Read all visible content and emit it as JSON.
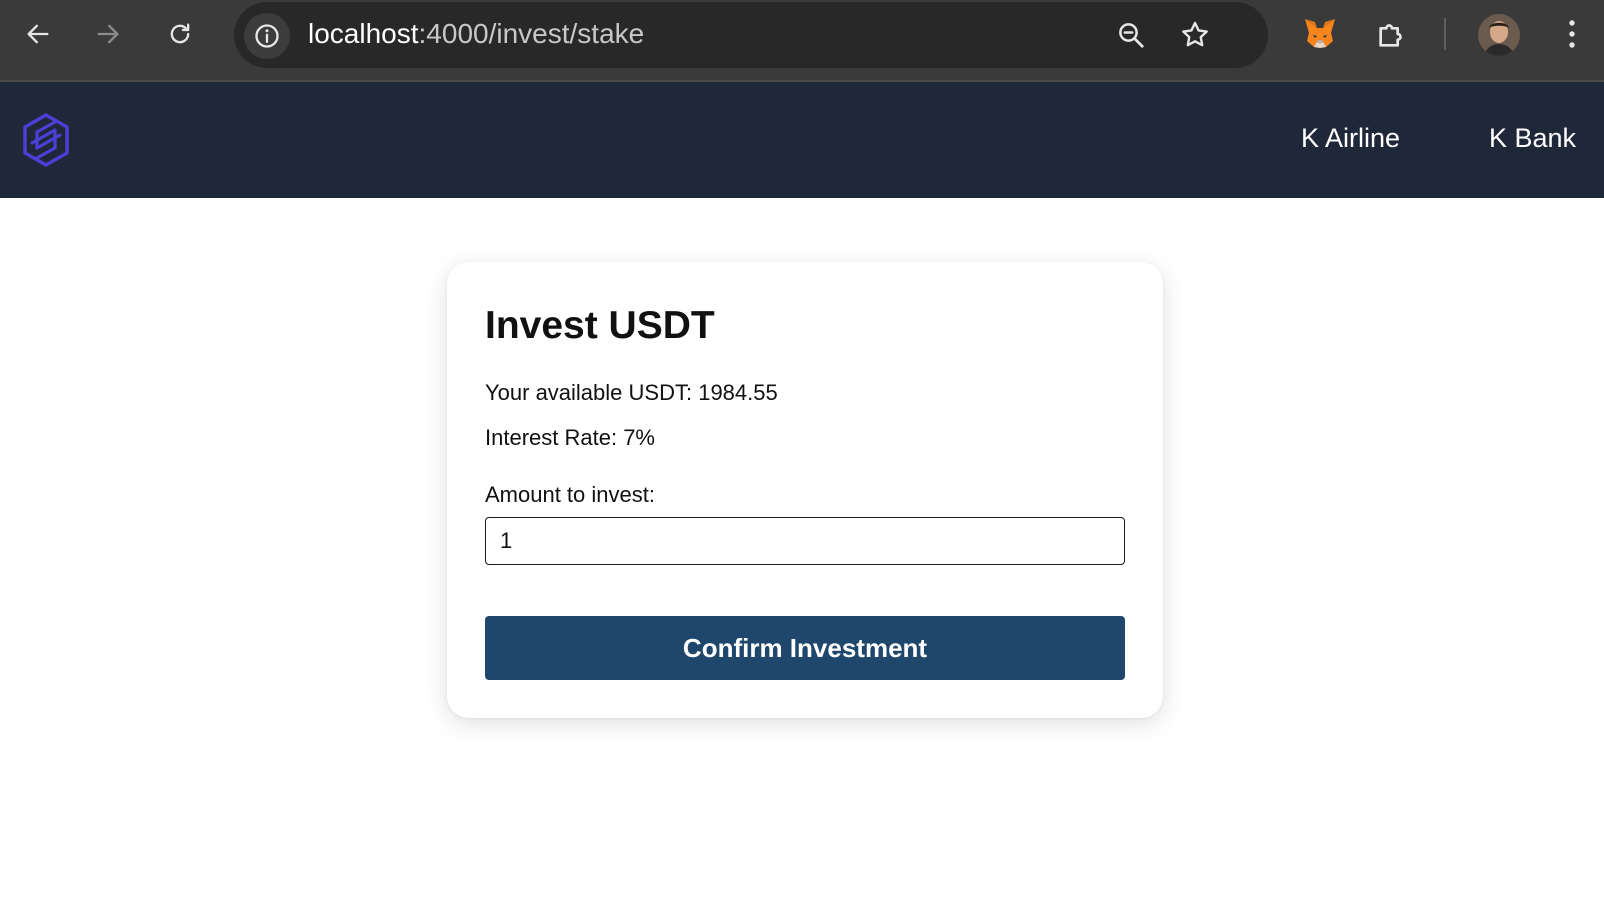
{
  "browser": {
    "url_host": "localhost",
    "url_path": ":4000/invest/stake",
    "icons": [
      "back-icon",
      "forward-icon",
      "reload-icon",
      "site-info-icon",
      "zoom-icon",
      "bookmark-star-icon",
      "metamask-fox-icon",
      "extensions-puzzle-icon",
      "profile-avatar",
      "kebab-menu-icon"
    ]
  },
  "header": {
    "logo": "app-logo-icon",
    "nav": [
      {
        "label": "K Airline"
      },
      {
        "label": "K Bank"
      }
    ]
  },
  "card": {
    "title": "Invest USDT",
    "available_label": "Your available USDT: ",
    "available_value": "1984.55",
    "interest_label": "Interest Rate: ",
    "interest_value": "7%",
    "amount_label": "Amount to invest:",
    "amount_value": "1",
    "confirm_label": "Confirm Investment"
  },
  "colors": {
    "chrome_bg": "#3a3a3a",
    "header_bg": "#1e2839",
    "logo_accent": "#4b3fd6",
    "button_bg": "#1f476b"
  }
}
